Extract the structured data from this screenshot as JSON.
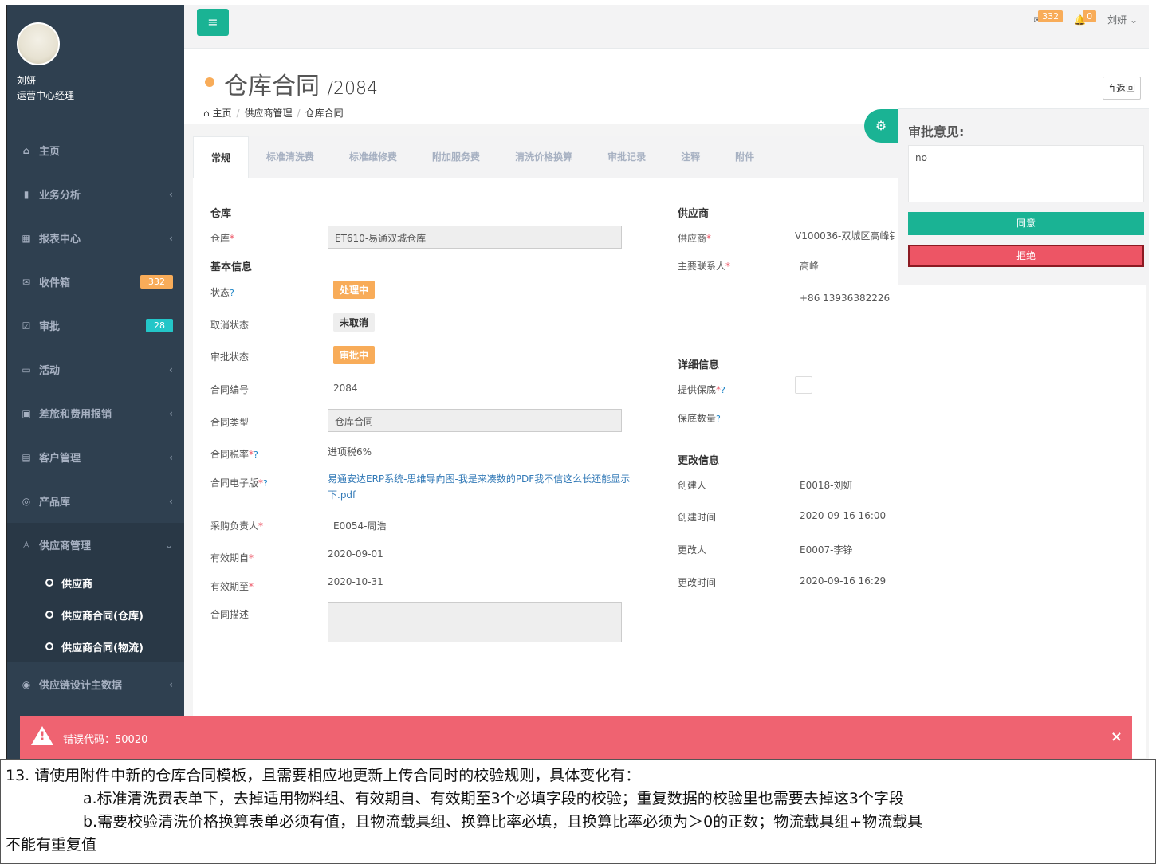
{
  "sidebar": {
    "user_name": "刘妍",
    "user_role": "运营中心经理",
    "items": [
      {
        "icon": "⌂",
        "label": "主页"
      },
      {
        "icon": "▮",
        "label": "业务分析"
      },
      {
        "icon": "▦",
        "label": "报表中心"
      },
      {
        "icon": "✉",
        "label": "收件箱",
        "badge": "332",
        "badge_color": "#f8ac59"
      },
      {
        "icon": "☑",
        "label": "审批",
        "badge": "28",
        "badge_color": "#23c6c8"
      },
      {
        "icon": "▭",
        "label": "活动"
      },
      {
        "icon": "▣",
        "label": "差旅和费用报销"
      },
      {
        "icon": "▤",
        "label": "客户管理"
      },
      {
        "icon": "◎",
        "label": "产品库"
      },
      {
        "icon": "♙",
        "label": "供应商管理"
      }
    ],
    "sub_items": [
      "供应商",
      "供应商合同(仓库)",
      "供应商合同(物流)"
    ],
    "after_item": {
      "icon": "◉",
      "label": "供应链设计主数据"
    }
  },
  "topbar": {
    "mail_count": "332",
    "bell_count": "0",
    "user": "刘妍"
  },
  "header": {
    "title": "仓库合同",
    "number": "/2084",
    "breadcrumb": [
      "主页",
      "供应商管理",
      "仓库合同"
    ],
    "back_label": "返回"
  },
  "tabs": [
    "常规",
    "标准清洗费",
    "标准维修费",
    "附加服务费",
    "清洗价格换算",
    "审批记录",
    "注释",
    "附件"
  ],
  "form": {
    "sec_warehouse": "仓库",
    "warehouse_label": "仓库",
    "warehouse_value": "ET610-易通双城仓库",
    "sec_basic": "基本信息",
    "status_label": "状态",
    "status_value": "处理中",
    "cancel_label": "取消状态",
    "cancel_value": "未取消",
    "approval_label": "审批状态",
    "approval_value": "审批中",
    "contract_no_label": "合同编号",
    "contract_no_value": "2084",
    "contract_type_label": "合同类型",
    "contract_type_value": "仓库合同",
    "tax_label": "合同税率",
    "tax_value": "进项税6%",
    "edoc_label": "合同电子版",
    "edoc_value": "易通安达ERP系统-思维导向图-我是来凑数的PDF我不信这么长还能显示下.pdf",
    "buyer_label": "采购负责人",
    "buyer_value": "E0054-周浩",
    "valid_from_label": "有效期自",
    "valid_from_value": "2020-09-01",
    "valid_to_label": "有效期至",
    "valid_to_value": "2020-10-31",
    "desc_label": "合同描述"
  },
  "right": {
    "sec_supplier": "供应商",
    "supplier_label": "供应商",
    "supplier_value": "V100036-双城区高峰钅",
    "contact_label": "主要联系人",
    "contact_value": "高峰",
    "phone_value": "+86 13936382226",
    "sec_detail": "详细信息",
    "deposit_label": "提供保底",
    "deposit_qty_label": "保底数量",
    "sec_change": "更改信息",
    "creator_label": "创建人",
    "creator_value": "E0018-刘妍",
    "created_label": "创建时间",
    "created_value": "2020-09-16 16:00",
    "modifier_label": "更改人",
    "modifier_value": "E0007-李铮",
    "modified_label": "更改时间",
    "modified_value": "2020-09-16 16:29"
  },
  "approve": {
    "title": "审批意见:",
    "comment": "no",
    "agree": "同意",
    "reject": "拒绝"
  },
  "toast": {
    "message": "错误代码：50020"
  },
  "notes": {
    "line1": "13. 请使用附件中新的仓库合同模板，且需要相应地更新上传合同时的校验规则，具体变化有：",
    "line2": "a.标准清洗费表单下，去掉适用物料组、有效期自、有效期至3个必填字段的校验；重复数据的校验里也需要去掉这3个字段",
    "line3": "b.需要校验清洗价格换算表单必须有值，且物流载具组、换算比率必填，且换算比率必须为＞0的正数；物流载具组+物流载具",
    "line4": "不能有重复值"
  }
}
